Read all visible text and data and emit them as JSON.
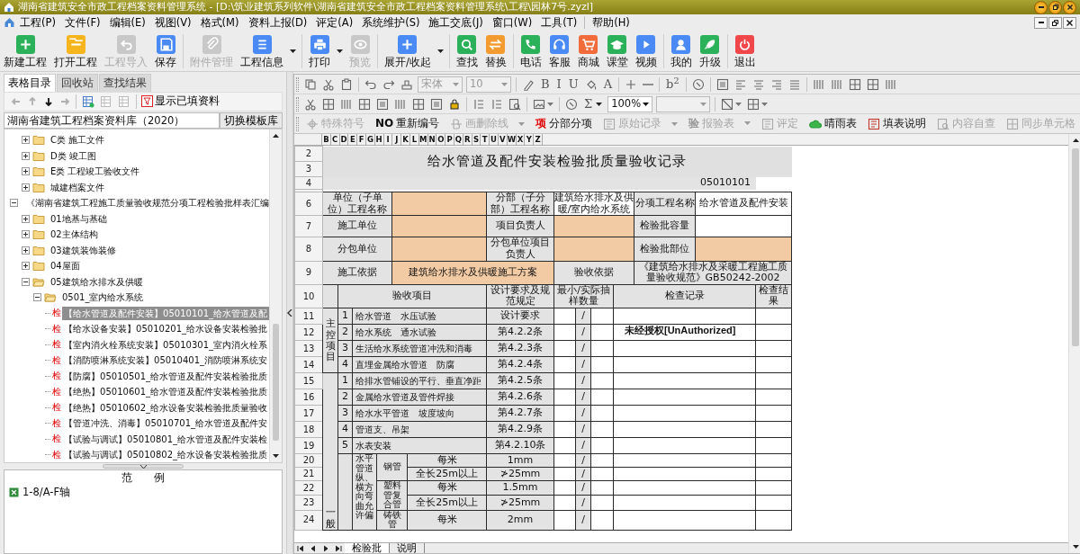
{
  "window": {
    "title": "湖南省建筑安全市政工程档案资料管理系统 - [D:\\筑业建筑系列软件\\湖南省建筑安全市政工程档案资料管理系统\\工程\\园林7号.zyzl]"
  },
  "menu": {
    "items": [
      "工程(P)",
      "文件(F)",
      "编辑(E)",
      "视图(V)",
      "格式(M)",
      "资料上报(D)",
      "评定(A)",
      "系统维护(S)",
      "施工交底(J)",
      "窗口(W)",
      "工具(T)"
    ],
    "help": "帮助(H)"
  },
  "toolbar": {
    "groups": [
      [
        {
          "label": "新建工程",
          "disabled": false
        },
        {
          "label": "打开工程",
          "disabled": false
        },
        {
          "label": "工程导入",
          "disabled": true
        },
        {
          "label": "保存",
          "disabled": false
        }
      ],
      [
        {
          "label": "附件管理",
          "disabled": true
        },
        {
          "label": "工程信息",
          "disabled": false,
          "dropdown": true
        }
      ],
      [
        {
          "label": "打印",
          "disabled": false,
          "dropdown": true
        },
        {
          "label": "预览",
          "disabled": true
        }
      ],
      [
        {
          "label": "展开/收起",
          "disabled": false,
          "dropdown": true
        }
      ],
      [
        {
          "label": "查找",
          "disabled": false
        },
        {
          "label": "替换",
          "disabled": false
        }
      ],
      [
        {
          "label": "电话",
          "disabled": false
        },
        {
          "label": "客服",
          "disabled": false
        },
        {
          "label": "商城",
          "disabled": false
        },
        {
          "label": "课堂",
          "disabled": false
        },
        {
          "label": "视频",
          "disabled": false
        }
      ],
      [
        {
          "label": "我的",
          "disabled": false
        },
        {
          "label": "升级",
          "disabled": false
        }
      ],
      [
        {
          "label": "退出",
          "disabled": false
        }
      ]
    ]
  },
  "format_toolbar": {
    "rows": [
      [
        {
          "kind": "icon"
        },
        {
          "kind": "icon"
        },
        {
          "kind": "icon"
        },
        {
          "kind": "sep"
        },
        {
          "kind": "icon"
        },
        {
          "kind": "icon"
        },
        {
          "kind": "icon"
        },
        {
          "kind": "combo",
          "value": "宋体",
          "disabled": true
        },
        {
          "kind": "combo",
          "value": "10",
          "disabled": true
        },
        {
          "kind": "sep"
        },
        {
          "kind": "icon"
        },
        {
          "kind": "glyph",
          "text": "B"
        },
        {
          "kind": "glyph",
          "text": "I"
        },
        {
          "kind": "glyph",
          "text": "U"
        },
        {
          "kind": "icon"
        },
        {
          "kind": "glyph",
          "text": "A"
        },
        {
          "kind": "sep"
        },
        {
          "kind": "icon"
        },
        {
          "kind": "icon"
        },
        {
          "kind": "sep"
        },
        {
          "kind": "glyph",
          "text": "b$^{2}$"
        },
        {
          "kind": "sep"
        },
        {
          "kind": "icon"
        },
        {
          "kind": "sep"
        },
        {
          "kind": "icon"
        },
        {
          "kind": "icon"
        },
        {
          "kind": "icon"
        },
        {
          "kind": "icon"
        },
        {
          "kind": "icon"
        },
        {
          "kind": "sep"
        },
        {
          "kind": "icon"
        },
        {
          "kind": "icon"
        },
        {
          "kind": "icon"
        },
        {
          "kind": "icon"
        },
        {
          "kind": "icon"
        }
      ],
      [
        {
          "kind": "icon"
        },
        {
          "kind": "icon"
        },
        {
          "kind": "icon"
        },
        {
          "kind": "icon"
        },
        {
          "kind": "icon"
        },
        {
          "kind": "icon"
        },
        {
          "kind": "icon"
        },
        {
          "kind": "icon"
        },
        {
          "kind": "icon"
        },
        {
          "kind": "sep"
        },
        {
          "kind": "icon"
        },
        {
          "kind": "icon"
        },
        {
          "kind": "icon"
        },
        {
          "kind": "sep"
        },
        {
          "kind": "icon",
          "dropdown": true
        },
        {
          "kind": "sep"
        },
        {
          "kind": "icon"
        },
        {
          "kind": "glyph",
          "text": "Σ",
          "dropdown": true
        },
        {
          "kind": "combo",
          "value": "100%",
          "disabled": false
        },
        {
          "kind": "combo",
          "disabled": true
        },
        {
          "kind": "sep"
        },
        {
          "kind": "icon",
          "dropdown": true
        },
        {
          "kind": "icon",
          "dropdown": true
        }
      ]
    ]
  },
  "action_bar": [
    {
      "label": "特殊符号",
      "disabled": true
    },
    {
      "label": "重新编号",
      "disabled": false,
      "icon_text": "NO",
      "color": "#111111"
    },
    {
      "label": "画删除线",
      "disabled": true,
      "dropdown": true
    },
    {
      "label": "分部分项",
      "disabled": false,
      "icon_text": "项",
      "color": "#e00000"
    },
    {
      "label": "原始记录",
      "disabled": true,
      "dropdown": true
    },
    {
      "label": "报验表",
      "disabled": true,
      "dropdown": true,
      "icon_text": "验",
      "color": "#999999"
    },
    {
      "label": "评定",
      "disabled": true
    },
    {
      "label": "晴雨表",
      "disabled": false
    },
    {
      "label": "填表说明",
      "disabled": false
    },
    {
      "label": "内容自查",
      "disabled": true
    },
    {
      "label": "同步单元格",
      "disabled": true
    }
  ],
  "left_panel": {
    "tabs": [
      {
        "label": "表格目录",
        "selected": true
      },
      {
        "label": "回收站",
        "selected": false
      },
      {
        "label": "查找结果",
        "selected": false
      }
    ],
    "nav": [
      {
        "disabled": true
      },
      {
        "disabled": true
      },
      {
        "disabled": false
      },
      {
        "disabled": true
      }
    ],
    "tools": [
      {
        "disabled": false
      },
      {
        "disabled": true
      },
      {
        "disabled": true
      }
    ],
    "filter_label": "显示已填资料",
    "library": "湖南省建筑工程档案资料库（2020）",
    "switch_button": "切换模板库",
    "tree": {
      "continued_items": [
        {
          "label": "C类 施工文件",
          "expanded": false
        },
        {
          "label": "D类 竣工图",
          "expanded": false
        },
        {
          "label": "E类 工程竣工验收文件",
          "expanded": false
        },
        {
          "label": "城建档案文件",
          "expanded": false
        }
      ],
      "items": [
        {
          "label": "《湖南省建筑工程施工质量验收规范分项工程检验批样表汇编",
          "expanded": true,
          "children": [
            {
              "label": "01地基与基础",
              "expanded": false
            },
            {
              "label": "02主体结构",
              "expanded": false
            },
            {
              "label": "03建筑装饰装修",
              "expanded": false
            },
            {
              "label": "04屋面",
              "expanded": false
            },
            {
              "label": "05建筑给水排水及供暖",
              "expanded": true,
              "children": [
                {
                  "label": "0501_室内给水系统",
                  "expanded": true,
                  "children": [
                    {
                      "tag": "检",
                      "label": "【给水管道及配件安装】05010101_给水管道及配",
                      "selected": true
                    },
                    {
                      "tag": "检",
                      "label": "【给水设备安装】05010201_给水设备安装检验批",
                      "selected": false
                    },
                    {
                      "tag": "检",
                      "label": "【室内消火栓系统安装】05010301_室内消火栓系",
                      "selected": false
                    },
                    {
                      "tag": "检",
                      "label": "【消防喷淋系统安装】05010401_消防喷淋系统安",
                      "selected": false
                    },
                    {
                      "tag": "检",
                      "label": "【防腐】05010501_给水管道及配件安装检验批质",
                      "selected": false
                    },
                    {
                      "tag": "检",
                      "label": "【绝热】05010601_给水管道及配件安装检验批质",
                      "selected": false
                    },
                    {
                      "tag": "检",
                      "label": "【绝热】05010602_给水设备安装检验批质量验收",
                      "selected": false
                    },
                    {
                      "tag": "检",
                      "label": "【管道冲洗、消毒】05010701_给水管道及配件安",
                      "selected": false
                    },
                    {
                      "tag": "检",
                      "label": "【试验与调试】05010801_给水管道及配件安装检",
                      "selected": false
                    },
                    {
                      "tag": "检",
                      "label": "【试验与调试】05010802_给水设备安装检验批质",
                      "selected": false
                    }
                  ]
                }
              ]
            }
          ]
        }
      ]
    },
    "example": {
      "title": "范　　例",
      "items": [
        {
          "label": "1-8/A-F轴"
        }
      ]
    }
  },
  "sheet": {
    "columns": [
      "B",
      "C",
      "D",
      "E",
      "F",
      "G",
      "H",
      "I",
      "J",
      "K",
      "L",
      "M",
      "N",
      "O",
      "P",
      "Q",
      "R",
      "S",
      "T",
      "U",
      "V",
      "W",
      "X",
      "Y",
      "Z"
    ],
    "form": {
      "title_rows": [
        "2",
        "3"
      ],
      "title": "给水管道及配件安装检验批质量验收记录",
      "code_row": "4",
      "code": "05010101",
      "info_rows": [
        {
          "row": "6",
          "cells": [
            {
              "kind": "label",
              "text": "单位（子单位）工程名称"
            },
            {
              "kind": "input"
            },
            {
              "kind": "label",
              "text": "分部（子分部）工程名称"
            },
            {
              "kind": "value",
              "text": "建筑给水排水及供暖/室内给水系统"
            },
            {
              "kind": "label",
              "text": "分项工程名称"
            },
            {
              "kind": "value",
              "text": "给水管道及配件安装"
            }
          ]
        },
        {
          "row": "7",
          "cells": [
            {
              "kind": "label",
              "text": "施工单位"
            },
            {
              "kind": "input"
            },
            {
              "kind": "label",
              "text": "项目负责人"
            },
            {
              "kind": "input"
            },
            {
              "kind": "label",
              "text": "检验批容量"
            },
            {
              "kind": "value"
            }
          ]
        },
        {
          "row": "8",
          "cells": [
            {
              "kind": "label",
              "text": "分包单位"
            },
            {
              "kind": "input"
            },
            {
              "kind": "label",
              "text": "分包单位项目负责人"
            },
            {
              "kind": "input"
            },
            {
              "kind": "label",
              "text": "检验批部位"
            },
            {
              "kind": "input"
            }
          ]
        },
        {
          "row": "9",
          "cells": [
            {
              "kind": "label",
              "text": "施工依据"
            },
            {
              "kind": "input",
              "text": "建筑给水排水及供暖施工方案"
            },
            {
              "kind": "label",
              "text": "验收依据"
            },
            {
              "kind": "label",
              "text": "《建筑给水排水及采暖工程施工质量验收规范》GB50242-2002"
            }
          ]
        }
      ],
      "header": {
        "row": "10",
        "item": "验收项目",
        "design": "设计要求及规范规定",
        "sample": "最小/实际抽样数量",
        "record": "检查记录",
        "result": "检查结果"
      },
      "groups": [
        {
          "label": "主控项目",
          "items": [
            {
              "row": "11",
              "index": "1",
              "name": "给水管道　水压试验",
              "design": "设计要求",
              "sample": "/"
            },
            {
              "row": "12",
              "index": "2",
              "name": "给水系统　通水试验",
              "design": "第4.2.2条",
              "sample": "/",
              "record": "未经授权[UnAuthorized]"
            },
            {
              "row": "13",
              "index": "3",
              "name": "生活给水系统管道冲洗和消毒",
              "design": "第4.2.3条",
              "sample": "/"
            },
            {
              "row": "14",
              "index": "4",
              "name": "直埋金属给水管道　防腐",
              "design": "第4.2.4条",
              "sample": "/"
            }
          ]
        },
        {
          "label": "一般",
          "items": [
            {
              "row": "15",
              "index": "1",
              "name": "给排水管铺设的平行、垂直净距",
              "design": "第4.2.5条",
              "sample": "/"
            },
            {
              "row": "16",
              "index": "2",
              "name": "金属给水管道及管件焊接",
              "design": "第4.2.6条",
              "sample": "/"
            },
            {
              "row": "17",
              "index": "3",
              "name": "给水水平管道　坡度坡向",
              "design": "第4.2.7条",
              "sample": "/"
            },
            {
              "row": "18",
              "index": "4",
              "name": "管道支、吊架",
              "design": "第4.2.9条",
              "sample": "/"
            },
            {
              "row": "19",
              "index": "5",
              "name": "水表安装",
              "design": "第4.2.10条",
              "sample": "/"
            }
          ],
          "deviation": {
            "label": "水平管道纵、横方向弯曲允许偏",
            "materials": [
              {
                "name": "钢管",
                "rows": [
                  {
                    "row": "20",
                    "measure": "每米",
                    "design": "1mm",
                    "sample": "/"
                  },
                  {
                    "row": "21",
                    "measure": "全长25m以上",
                    "design": "≯25mm",
                    "sample": "/"
                  }
                ]
              },
              {
                "name": "塑料管复合管",
                "rows": [
                  {
                    "row": "22",
                    "measure": "每米",
                    "design": "1.5mm",
                    "sample": "/"
                  },
                  {
                    "row": "23",
                    "measure": "全长25m以上",
                    "design": "≯25mm",
                    "sample": "/"
                  }
                ]
              },
              {
                "name": "铸铁管",
                "rows": [
                  {
                    "row": "24",
                    "measure": "每米",
                    "design": "2mm",
                    "sample": "/"
                  }
                ]
              }
            ]
          }
        }
      ]
    },
    "tabs": [
      {
        "label": "检验批",
        "selected": true
      },
      {
        "label": "说明",
        "selected": false
      }
    ]
  }
}
